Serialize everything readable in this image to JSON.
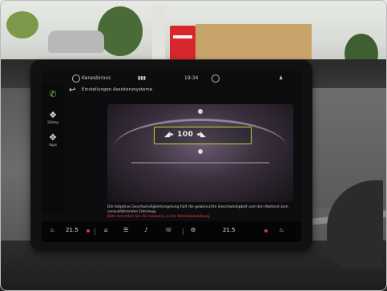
{
  "statusbar": {
    "left_label": "Kenesbirovs",
    "time": "19:34"
  },
  "rail": {
    "items": [
      {
        "label": "",
        "glyph": "✆"
      },
      {
        "label": "Sitzing",
        "glyph": "❖"
      },
      {
        "label": "Apps",
        "glyph": "✥"
      }
    ]
  },
  "page": {
    "title": "Einstellungen Assistenzsysteme"
  },
  "visual": {
    "hud_text": "◢▸ 100 ◂◣"
  },
  "description": {
    "line1": "Die Adaptive Geschwindigkeitsregelung hält die gewünschte Geschwindigkeit und den Abstand zum vorausfahrenden Fahrzeug.",
    "line2": "Bitte beachten Sie die Hinweise in der Betriebsanleitung."
  },
  "bottombar": {
    "temp_left": "21.5",
    "temp_right": "21.5",
    "items": [
      "⌂",
      "☰",
      "♪",
      "☏",
      "⚙"
    ]
  },
  "colors": {
    "accent_green": "#7ac143",
    "highlight": "#b9d53c",
    "alert_red": "#d93a3a"
  },
  "icons": {
    "back": "back-arrow-icon",
    "phone": "phone-icon",
    "home": "home-icon",
    "menu": "menu-icon",
    "music": "music-icon",
    "call": "call-icon",
    "settings": "gear-icon",
    "seat": "seat-icon"
  }
}
